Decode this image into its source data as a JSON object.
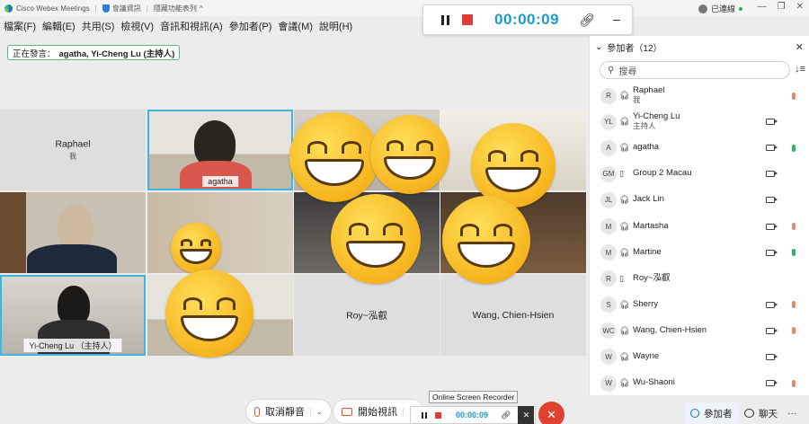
{
  "titlebar": {
    "app_name": "Cisco Webex Meetings",
    "meeting_info": "會議資訊",
    "hidden_menu": "隱藏功能表列",
    "caret": "^",
    "connected": "已連線",
    "minimize": "—",
    "restore": "❐",
    "close": "✕"
  },
  "menubar": [
    "檔案(F)",
    "編輯(E)",
    "共用(S)",
    "檢視(V)",
    "音訊和視訊(A)",
    "參加者(P)",
    "會議(M)",
    "說明(H)"
  ],
  "recorder": {
    "time": "00:00:09",
    "tooltip": "Online Screen Recorder",
    "bottom_time": "00:00:09",
    "close": "✕"
  },
  "speaking": {
    "label": "正在發言：",
    "names": "agatha, Yi-Cheng Lu (主持人)"
  },
  "tiles": {
    "raphael": {
      "name": "Raphael",
      "sub": "我"
    },
    "agatha": {
      "name": "agatha"
    },
    "yicheng": {
      "name": "Yi-Cheng Lu （主持人）"
    },
    "roy": {
      "name": "Roy~泓叡"
    },
    "wang": {
      "name": "Wang, Chien-Hsien"
    }
  },
  "panel": {
    "title": "參加者（12）",
    "close": "✕",
    "search_placeholder": "搜尋",
    "sort_icon": "↓≡",
    "participants": [
      {
        "initials": "R",
        "name": "Raphael",
        "sub": "我",
        "headset": true,
        "camera": false,
        "mic": "muted"
      },
      {
        "initials": "YL",
        "name": "Yi-Cheng Lu",
        "sub": "主持人",
        "headset": true,
        "camera": true,
        "mic": "none"
      },
      {
        "initials": "A",
        "name": "agatha",
        "sub": "",
        "headset": true,
        "camera": true,
        "mic": "on"
      },
      {
        "initials": "GM",
        "name": "Group 2 Macau",
        "sub": "",
        "headset": false,
        "camera": true,
        "mic": "none"
      },
      {
        "initials": "JL",
        "name": "Jack Lin",
        "sub": "",
        "headset": true,
        "camera": true,
        "mic": "none"
      },
      {
        "initials": "M",
        "name": "Martasha",
        "sub": "",
        "headset": true,
        "camera": true,
        "mic": "muted"
      },
      {
        "initials": "M",
        "name": "Martine",
        "sub": "",
        "headset": true,
        "camera": true,
        "mic": "on"
      },
      {
        "initials": "R",
        "name": "Roy~泓叡",
        "sub": "",
        "headset": false,
        "camera": false,
        "mic": "none"
      },
      {
        "initials": "S",
        "name": "Sherry",
        "sub": "",
        "headset": true,
        "camera": true,
        "mic": "muted"
      },
      {
        "initials": "WC",
        "name": "Wang, Chien-Hsien",
        "sub": "",
        "headset": true,
        "camera": true,
        "mic": "muted"
      },
      {
        "initials": "W",
        "name": "Wayne",
        "sub": "",
        "headset": true,
        "camera": true,
        "mic": "none"
      },
      {
        "initials": "W",
        "name": "Wu-Shaoni",
        "sub": "",
        "headset": true,
        "camera": true,
        "mic": "muted"
      }
    ]
  },
  "bottom": {
    "unmute": "取消靜音",
    "start_video": "開始視訊",
    "caret": "⌄",
    "participants": "參加者",
    "chat": "聊天",
    "more": "···"
  },
  "colors": {
    "accent": "#1b9bd0",
    "end": "#e0412f",
    "active_tile": "#3fb5e0"
  }
}
